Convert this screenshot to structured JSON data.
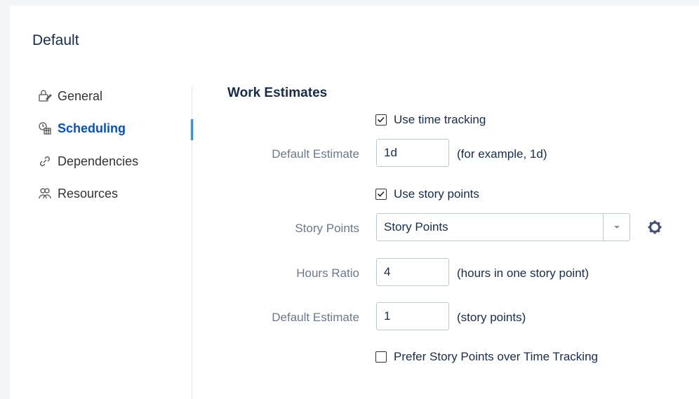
{
  "page": {
    "title": "Default"
  },
  "nav": {
    "items": [
      {
        "label": "General",
        "icon": "general-icon"
      },
      {
        "label": "Scheduling",
        "icon": "scheduling-icon",
        "active": true
      },
      {
        "label": "Dependencies",
        "icon": "link-icon"
      },
      {
        "label": "Resources",
        "icon": "people-icon"
      }
    ]
  },
  "section": {
    "title": "Work Estimates"
  },
  "time_tracking": {
    "label": "Use time tracking",
    "checked": true
  },
  "default_estimate_time": {
    "label": "Default Estimate",
    "value": "1d",
    "hint": "(for example, 1d)"
  },
  "story_points_toggle": {
    "label": "Use story points",
    "checked": true
  },
  "story_points": {
    "label": "Story Points",
    "selected": "Story Points"
  },
  "hours_ratio": {
    "label": "Hours Ratio",
    "value": "4",
    "hint": "(hours in one story point)"
  },
  "default_estimate_points": {
    "label": "Default Estimate",
    "value": "1",
    "hint": "(story points)"
  },
  "prefer_story_points": {
    "label": "Prefer Story Points over Time Tracking",
    "checked": false
  },
  "colors": {
    "accent": "#0052cc",
    "label": "#6b778c",
    "text": "#172b4d",
    "border": "#c1c7d0"
  }
}
